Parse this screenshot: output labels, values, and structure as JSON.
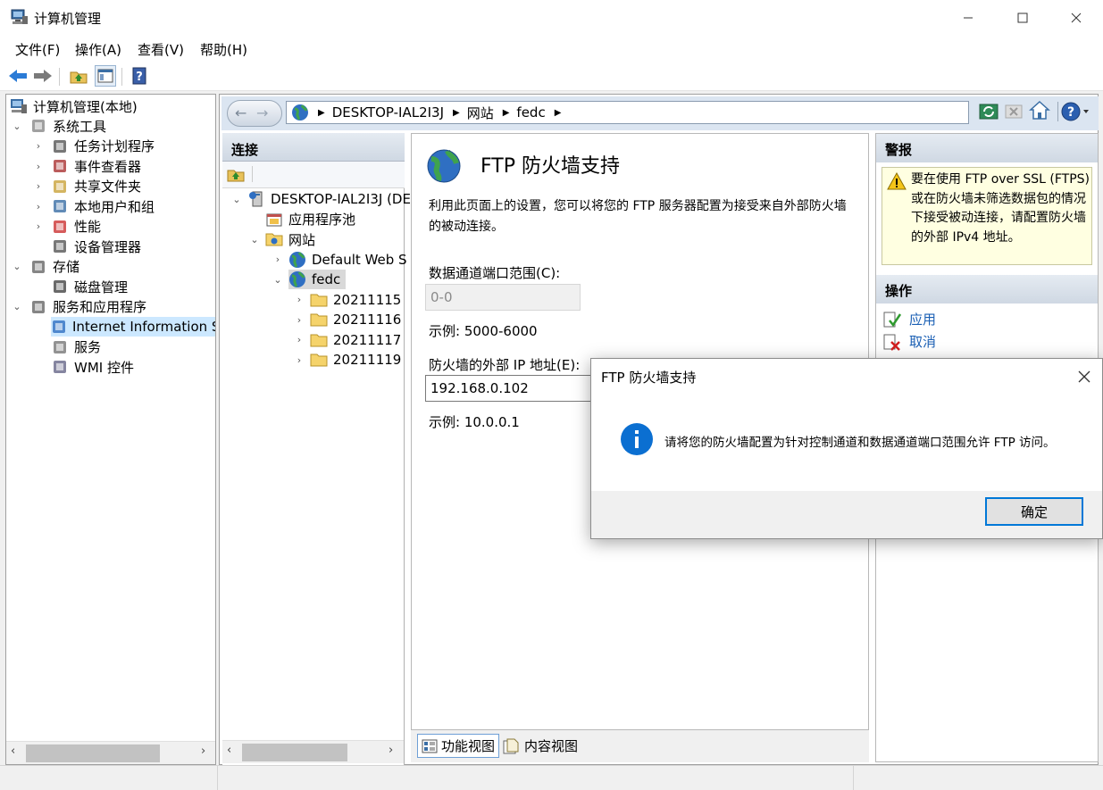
{
  "window": {
    "title": "计算机管理"
  },
  "menu": [
    "文件(F)",
    "操作(A)",
    "查看(V)",
    "帮助(H)"
  ],
  "left_tree": {
    "root": "计算机管理(本地)",
    "items": [
      {
        "label": "系统工具",
        "level": 1,
        "state": "expanded"
      },
      {
        "label": "任务计划程序",
        "level": 2,
        "state": "collapsed"
      },
      {
        "label": "事件查看器",
        "level": 2,
        "state": "collapsed"
      },
      {
        "label": "共享文件夹",
        "level": 2,
        "state": "collapsed"
      },
      {
        "label": "本地用户和组",
        "level": 2,
        "state": "collapsed"
      },
      {
        "label": "性能",
        "level": 2,
        "state": "collapsed"
      },
      {
        "label": "设备管理器",
        "level": 2,
        "state": "none"
      },
      {
        "label": "存储",
        "level": 1,
        "state": "expanded"
      },
      {
        "label": "磁盘管理",
        "level": 2,
        "state": "none"
      },
      {
        "label": "服务和应用程序",
        "level": 1,
        "state": "expanded"
      },
      {
        "label": "Internet Information Se",
        "level": 2,
        "state": "selected"
      },
      {
        "label": "服务",
        "level": 2,
        "state": "none"
      },
      {
        "label": "WMI 控件",
        "level": 2,
        "state": "none"
      }
    ]
  },
  "address_bar": {
    "crumbs": [
      "DESKTOP-IAL2I3J",
      "网站",
      "fedc"
    ]
  },
  "connections": {
    "title": "连接",
    "items": [
      {
        "label": "DESKTOP-IAL2I3J (DE",
        "level": 0
      },
      {
        "label": "应用程序池",
        "level": 1
      },
      {
        "label": "网站",
        "level": 1
      },
      {
        "label": "Default Web S",
        "level": 2
      },
      {
        "label": "fedc",
        "level": 2
      },
      {
        "label": "20211115",
        "level": 3
      },
      {
        "label": "20211116",
        "level": 3
      },
      {
        "label": "20211117",
        "level": 3
      },
      {
        "label": "20211119",
        "level": 3
      }
    ]
  },
  "main": {
    "title": "FTP 防火墙支持",
    "description": "利用此页面上的设置，您可以将您的 FTP 服务器配置为接受来自外部防火墙的被动连接。",
    "port_range_label": "数据通道端口范围(C):",
    "port_range_value": "0-0",
    "port_example": "示例: 5000-6000",
    "ext_ip_label": "防火墙的外部 IP 地址(E):",
    "ext_ip_value": "192.168.0.102",
    "ip_example": "示例: 10.0.0.1"
  },
  "alerts": {
    "title": "警报",
    "message": "要在使用 FTP over SSL (FTPS)或在防火墙未筛选数据包的情况下接受被动连接，请配置防火墙的外部 IPv4 地址。"
  },
  "actions": {
    "title": "操作",
    "apply": "应用",
    "cancel": "取消"
  },
  "bottom_tabs": {
    "features": "功能视图",
    "content": "内容视图"
  },
  "dialog": {
    "title": "FTP 防火墙支持",
    "message": "请将您的防火墙配置为针对控制通道和数据通道端口范围允许 FTP 访问。",
    "ok": "确定"
  }
}
